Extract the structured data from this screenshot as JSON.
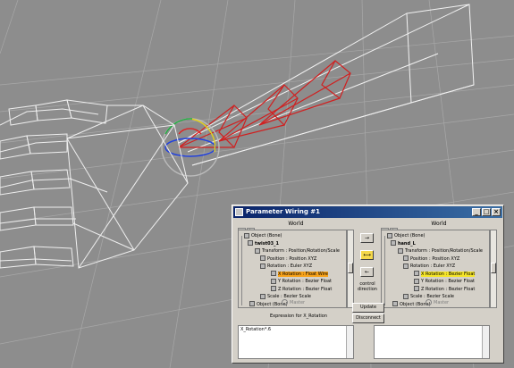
{
  "window": {
    "title": "Parameter Wiring #1"
  },
  "panes": {
    "left_label": "World",
    "right_label": "World"
  },
  "left_tree": [
    {
      "label": "Object (Bone)",
      "bold": false,
      "hl": ""
    },
    {
      "label": "twist03_1",
      "bold": true,
      "hl": ""
    },
    {
      "label": "Transform : Position/Rotation/Scale",
      "bold": false,
      "hl": ""
    },
    {
      "label": "Position : Position XYZ",
      "bold": false,
      "hl": ""
    },
    {
      "label": "Rotation : Euler XYZ",
      "bold": false,
      "hl": ""
    },
    {
      "label": "X Rotation : Float Wire",
      "bold": false,
      "hl": "orange"
    },
    {
      "label": "Y Rotation : Bezier Float",
      "bold": false,
      "hl": ""
    },
    {
      "label": "Z Rotation : Bezier Float",
      "bold": false,
      "hl": ""
    },
    {
      "label": "Scale : Bezier Scale",
      "bold": false,
      "hl": ""
    },
    {
      "label": "Object (Bone)",
      "bold": false,
      "hl": ""
    }
  ],
  "right_tree": [
    {
      "label": "Object (Bone)",
      "bold": false,
      "hl": ""
    },
    {
      "label": "hand_L",
      "bold": true,
      "hl": ""
    },
    {
      "label": "Transform : Position/Rotation/Scale",
      "bold": false,
      "hl": ""
    },
    {
      "label": "Position : Position XYZ",
      "bold": false,
      "hl": ""
    },
    {
      "label": "Rotation : Euler XYZ",
      "bold": false,
      "hl": ""
    },
    {
      "label": "X Rotation : Bezier Float",
      "bold": false,
      "hl": "yellow"
    },
    {
      "label": "Y Rotation : Bezier Float",
      "bold": false,
      "hl": ""
    },
    {
      "label": "Z Rotation : Bezier Float",
      "bold": false,
      "hl": ""
    },
    {
      "label": "Scale : Bezier Scale",
      "bold": false,
      "hl": ""
    },
    {
      "label": "Object (Bone)",
      "bold": false,
      "hl": ""
    }
  ],
  "direction": {
    "right_arrow": "→",
    "both_arrow": "⟷",
    "left_arrow": "←",
    "label": "control direction"
  },
  "master": {
    "left": "Master",
    "right": "Master"
  },
  "buttons": {
    "update": "Update",
    "disconnect": "Disconnect"
  },
  "expression": {
    "label": "Expression for X_Rotation",
    "left_text": "X_Rotation*.6",
    "right_text": ""
  },
  "colors": {
    "viewport": "#8d8d8d",
    "selected_bones": "#c02020",
    "title_bar": "#0a246a"
  },
  "icons": {
    "window": "dialog-icon",
    "minimize": "minimize-icon",
    "maximize": "maximize-icon",
    "close": "close-icon"
  }
}
